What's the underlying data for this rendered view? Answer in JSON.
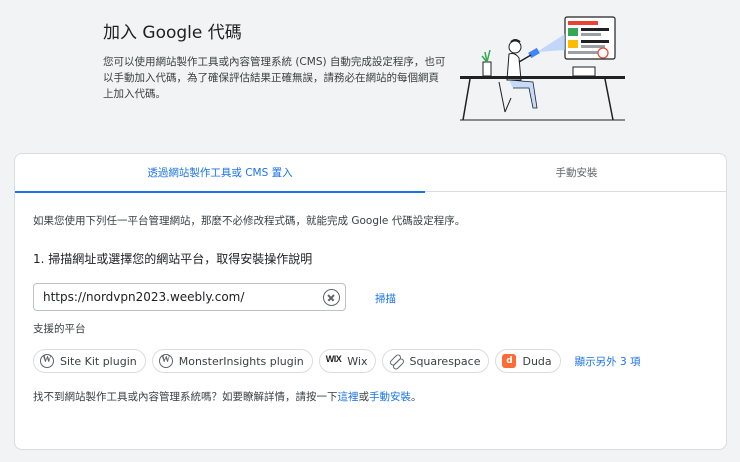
{
  "header": {
    "title": "加入 Google 代碼",
    "description": "您可以使用網站製作工具或內容管理系統 (CMS) 自動完成設定程序，也可以手動加入代碼，為了確保評估結果正確無誤，請務必在網站的每個網頁上加入代碼。"
  },
  "tabs": [
    {
      "label": "透過網站製作工具或 CMS 置入"
    },
    {
      "label": "手動安裝"
    }
  ],
  "panel": {
    "intro": "如果您使用下列任一平台管理網站，那麼不必修改程式碼，就能完成 Google 代碼設定程序。",
    "step1": "1. 掃描網址或選擇您的網站平台，取得安裝操作說明",
    "url_value": "https://nordvpn2023.weebly.com/",
    "scan_label": "掃描",
    "platforms_label": "支援的平台",
    "platforms": [
      {
        "label": "Site Kit plugin",
        "icon": "wordpress-icon"
      },
      {
        "label": "MonsterInsights plugin",
        "icon": "wordpress-icon"
      },
      {
        "label": "Wix",
        "icon": "wix-icon"
      },
      {
        "label": "Squarespace",
        "icon": "squarespace-icon"
      },
      {
        "label": "Duda",
        "icon": "duda-icon"
      }
    ],
    "more_label": "顯示另外 3 項",
    "footer_prefix": "找不到網站製作工具或內容管理系統嗎？如要瞭解詳情，請按一下",
    "footer_link1": "這裡",
    "footer_or": "或",
    "footer_link2": "手動安裝",
    "footer_suffix": "。"
  },
  "colors": {
    "accent": "#1a73e8",
    "background": "#f1f3f4",
    "duda": "#ff6b35"
  }
}
